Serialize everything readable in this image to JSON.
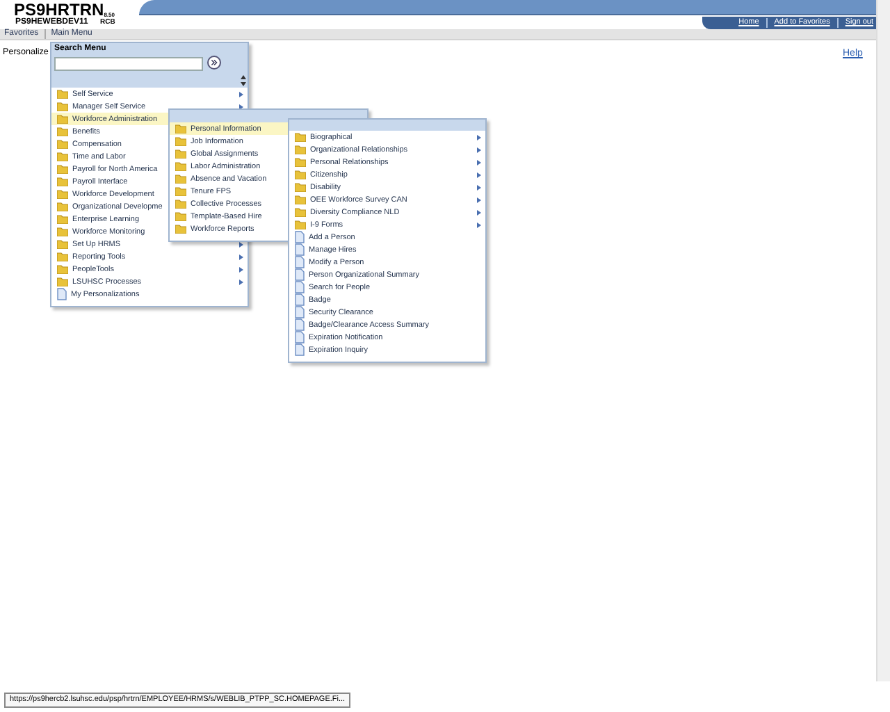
{
  "header": {
    "title": "PS9HRTRN",
    "version": "8.50",
    "server": "PS9HEWEBDEV11",
    "user": "RCB",
    "links": [
      "Home",
      "Add to Favorites",
      "Sign out"
    ]
  },
  "nav": [
    "Favorites",
    "Main Menu"
  ],
  "page": {
    "personalize": "Personalize",
    "help": "Help"
  },
  "search_menu": {
    "title": "Search Menu"
  },
  "menus": [
    {
      "items": [
        {
          "label": "Self Service",
          "kind": "folder",
          "submenu": true,
          "selected": false
        },
        {
          "label": "Manager Self Service",
          "kind": "folder",
          "submenu": true,
          "selected": false
        },
        {
          "label": "Workforce Administration",
          "kind": "folder",
          "submenu": false,
          "selected": true
        },
        {
          "label": "Benefits",
          "kind": "folder",
          "submenu": false,
          "selected": false
        },
        {
          "label": "Compensation",
          "kind": "folder",
          "submenu": false,
          "selected": false
        },
        {
          "label": "Time and Labor",
          "kind": "folder",
          "submenu": false,
          "selected": false
        },
        {
          "label": "Payroll for North America",
          "kind": "folder",
          "submenu": false,
          "selected": false
        },
        {
          "label": "Payroll Interface",
          "kind": "folder",
          "submenu": false,
          "selected": false
        },
        {
          "label": "Workforce Development",
          "kind": "folder",
          "submenu": false,
          "selected": false
        },
        {
          "label": "Organizational Developme",
          "kind": "folder",
          "submenu": false,
          "selected": false
        },
        {
          "label": "Enterprise Learning",
          "kind": "folder",
          "submenu": false,
          "selected": false
        },
        {
          "label": "Workforce Monitoring",
          "kind": "folder",
          "submenu": false,
          "selected": false
        },
        {
          "label": "Set Up HRMS",
          "kind": "folder",
          "submenu": true,
          "selected": false
        },
        {
          "label": "Reporting Tools",
          "kind": "folder",
          "submenu": true,
          "selected": false
        },
        {
          "label": "PeopleTools",
          "kind": "folder",
          "submenu": true,
          "selected": false
        },
        {
          "label": "LSUHSC Processes",
          "kind": "folder",
          "submenu": true,
          "selected": false
        },
        {
          "label": "My Personalizations",
          "kind": "page",
          "submenu": false,
          "selected": false
        }
      ]
    },
    {
      "items": [
        {
          "label": "Personal Information",
          "kind": "folder",
          "submenu": false,
          "selected": true
        },
        {
          "label": "Job Information",
          "kind": "folder",
          "submenu": false,
          "selected": false
        },
        {
          "label": "Global Assignments",
          "kind": "folder",
          "submenu": false,
          "selected": false
        },
        {
          "label": "Labor Administration",
          "kind": "folder",
          "submenu": false,
          "selected": false
        },
        {
          "label": "Absence and Vacation",
          "kind": "folder",
          "submenu": false,
          "selected": false
        },
        {
          "label": "Tenure FPS",
          "kind": "folder",
          "submenu": false,
          "selected": false
        },
        {
          "label": "Collective Processes",
          "kind": "folder",
          "submenu": false,
          "selected": false
        },
        {
          "label": "Template-Based Hire",
          "kind": "folder",
          "submenu": false,
          "selected": false
        },
        {
          "label": "Workforce Reports",
          "kind": "folder",
          "submenu": false,
          "selected": false
        }
      ]
    },
    {
      "items": [
        {
          "label": "Biographical",
          "kind": "folder",
          "submenu": true,
          "selected": false
        },
        {
          "label": "Organizational Relationships",
          "kind": "folder",
          "submenu": true,
          "selected": false
        },
        {
          "label": "Personal Relationships",
          "kind": "folder",
          "submenu": true,
          "selected": false
        },
        {
          "label": "Citizenship",
          "kind": "folder",
          "submenu": true,
          "selected": false
        },
        {
          "label": "Disability",
          "kind": "folder",
          "submenu": true,
          "selected": false
        },
        {
          "label": "OEE Workforce Survey CAN",
          "kind": "folder",
          "submenu": true,
          "selected": false
        },
        {
          "label": "Diversity Compliance NLD",
          "kind": "folder",
          "submenu": true,
          "selected": false
        },
        {
          "label": "I-9 Forms",
          "kind": "folder",
          "submenu": true,
          "selected": false
        },
        {
          "label": "Add a Person",
          "kind": "page",
          "submenu": false,
          "selected": false
        },
        {
          "label": "Manage Hires",
          "kind": "page",
          "submenu": false,
          "selected": false
        },
        {
          "label": "Modify a Person",
          "kind": "page",
          "submenu": false,
          "selected": false
        },
        {
          "label": "Person Organizational Summary",
          "kind": "page",
          "submenu": false,
          "selected": false
        },
        {
          "label": "Search for People",
          "kind": "page",
          "submenu": false,
          "selected": false
        },
        {
          "label": "Badge",
          "kind": "page",
          "submenu": false,
          "selected": false
        },
        {
          "label": "Security Clearance",
          "kind": "page",
          "submenu": false,
          "selected": false
        },
        {
          "label": "Badge/Clearance Access Summary",
          "kind": "page",
          "submenu": false,
          "selected": false
        },
        {
          "label": "Expiration Notification",
          "kind": "page",
          "submenu": false,
          "selected": false
        },
        {
          "label": "Expiration Inquiry",
          "kind": "page",
          "submenu": false,
          "selected": false
        }
      ]
    }
  ],
  "status_bar": {
    "url": "https://ps9hercb2.lsuhsc.edu/psp/hrtrn/EMPLOYEE/HRMS/s/WEBLIB_PTPP_SC.HOMEPAGE.Fi..."
  }
}
